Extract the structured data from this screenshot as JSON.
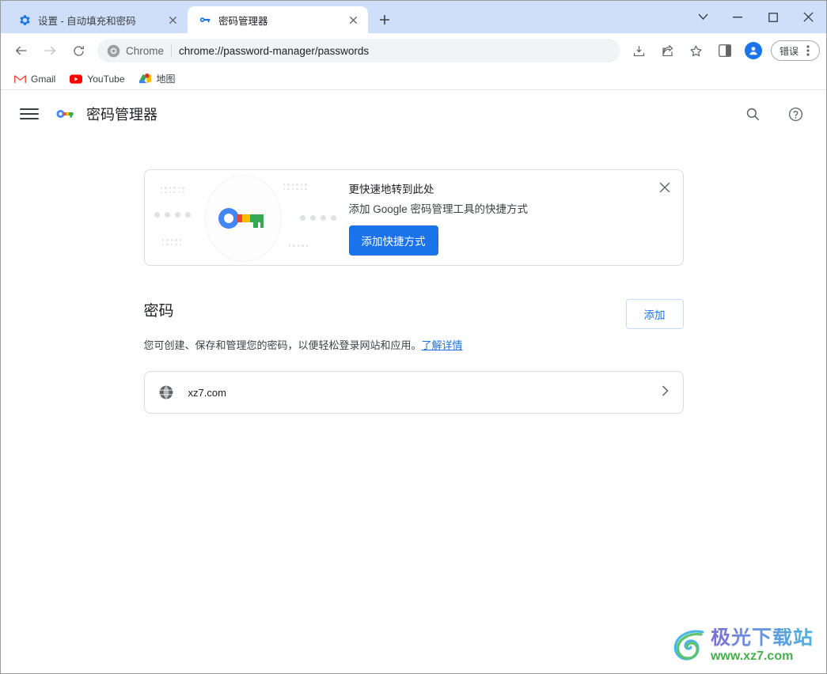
{
  "window_controls": {
    "tab_search": "tab-search-chevron",
    "minimize": "minimize",
    "maximize": "maximize",
    "close": "close"
  },
  "tabs": [
    {
      "title": "设置 - 自动填充和密码",
      "favicon": "settings-gear-icon",
      "active": false
    },
    {
      "title": "密码管理器",
      "favicon": "key-icon",
      "active": true
    }
  ],
  "new_tab_label": "+",
  "toolbar": {
    "back": "back-arrow",
    "forward": "forward-arrow",
    "reload": "reload",
    "omnibox": {
      "site_label": "Chrome",
      "url": "chrome://password-manager/passwords"
    },
    "download_icon": "download-icon",
    "share_icon": "share-icon",
    "bookmark_icon": "star-icon",
    "side_panel_icon": "side-panel-icon",
    "profile_icon": "profile-avatar",
    "error_pill_label": "错误",
    "menu_icon": "three-dot-menu"
  },
  "bookmarks": [
    {
      "label": "Gmail",
      "icon": "gmail-icon"
    },
    {
      "label": "YouTube",
      "icon": "youtube-icon"
    },
    {
      "label": "地图",
      "icon": "maps-icon"
    }
  ],
  "page": {
    "header": {
      "menu_icon": "hamburger-menu-icon",
      "logo": "google-password-manager-key-logo",
      "title": "密码管理器",
      "search_icon": "search-icon",
      "help_icon": "help-circle-icon"
    },
    "promo": {
      "line1": "更快速地转到此处",
      "line2": "添加 Google 密码管理工具的快捷方式",
      "button": "添加快捷方式",
      "close_icon": "close-icon",
      "illustration": "google-key-illustration"
    },
    "passwords_section": {
      "title": "密码",
      "add_button": "添加",
      "description": "您可创建、保存和管理您的密码，以便轻松登录网站和应用。",
      "learn_more": "了解详情",
      "entries": [
        {
          "site": "xz7.com",
          "favicon": "globe-icon",
          "chevron": "chevron-right-icon"
        }
      ]
    }
  },
  "watermark": {
    "cn_text": "极光下载站",
    "url_text": "www.xz7.com"
  },
  "colors": {
    "tabstrip_bg": "#cfdef9",
    "accent_blue": "#1a73e8",
    "omnibox_bg": "#f1f3f4",
    "border": "#dadce0",
    "watermark_green": "#45b04a"
  }
}
